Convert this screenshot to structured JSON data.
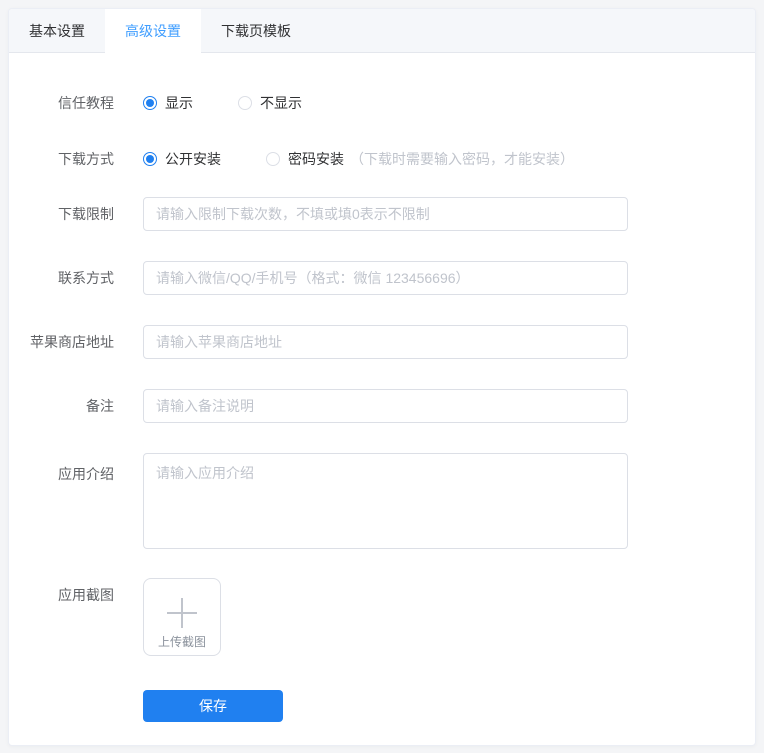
{
  "colors": {
    "accent": "#2080f0",
    "tab_active": "#409eff"
  },
  "tabs": [
    {
      "label": "基本设置",
      "active": false
    },
    {
      "label": "高级设置",
      "active": true
    },
    {
      "label": "下载页模板",
      "active": false
    }
  ],
  "form": {
    "trust_tutorial": {
      "label": "信任教程",
      "options": [
        {
          "label": "显示",
          "checked": true
        },
        {
          "label": "不显示",
          "checked": false
        }
      ]
    },
    "download_method": {
      "label": "下载方式",
      "options": [
        {
          "label": "公开安装",
          "checked": true
        },
        {
          "label": "密码安装",
          "checked": false
        }
      ],
      "note": "（下载时需要输入密码，才能安装）"
    },
    "download_limit": {
      "label": "下载限制",
      "value": "",
      "placeholder": "请输入限制下载次数，不填或填0表示不限制"
    },
    "contact": {
      "label": "联系方式",
      "value": "",
      "placeholder": "请输入微信/QQ/手机号（格式：微信 123456696）"
    },
    "apple_store": {
      "label": "苹果商店地址",
      "value": "",
      "placeholder": "请输入苹果商店地址"
    },
    "remark": {
      "label": "备注",
      "value": "",
      "placeholder": "请输入备注说明"
    },
    "app_intro": {
      "label": "应用介绍",
      "value": "",
      "placeholder": "请输入应用介绍"
    },
    "app_screenshot": {
      "label": "应用截图",
      "upload_label": "上传截图"
    }
  },
  "save_button": {
    "label": "保存"
  }
}
